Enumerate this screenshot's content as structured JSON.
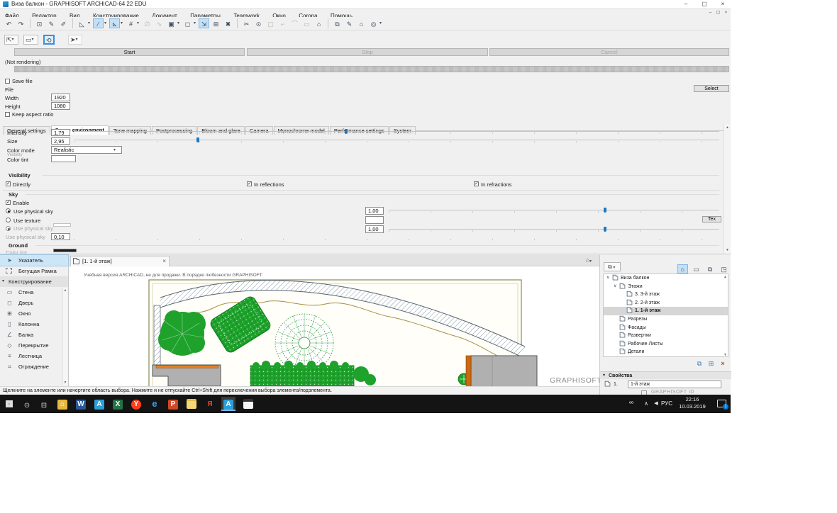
{
  "window": {
    "title": "Виза балкон - GRAPHISOFT ARCHICAD-64 22 EDU"
  },
  "icons": {
    "minimize": "–",
    "restore": "▢",
    "close": "×",
    "caret": "▾",
    "expander": "∨",
    "up": "▲",
    "down": "▼",
    "check": "✓",
    "house": "⌂",
    "folder_modes": "▭",
    "layouts": "⧉",
    "publisher": "◳",
    "chooser": "⧉",
    "copy": "⧉",
    "newfolder": "⊞",
    "delete": "×",
    "tab_house": "⌂",
    "people": "ºº",
    "chevron_up": "∧",
    "volume": "◀"
  },
  "menu": {
    "items": [
      "Файл",
      "Редактор",
      "Вид",
      "Конструирование",
      "Документ",
      "Параметры",
      "Teamwork",
      "Окно",
      "Corona",
      "Помощь"
    ]
  },
  "toolbar": {
    "glyphs": [
      "↶",
      "↷",
      "⊡",
      "✎",
      "✐",
      "◺",
      "∕",
      "⊾",
      "#",
      "∅",
      "∿",
      "▣",
      "◻",
      "⇲",
      "⊞",
      "✖",
      "✂",
      "⊙",
      "▢",
      "⌐",
      "⌒",
      "▭",
      "⌂",
      "⧉",
      "✎",
      "⌂",
      "◎"
    ]
  },
  "toolbar2": {
    "glyphs": [
      "⇱",
      "▭",
      "⟲",
      "➤"
    ]
  },
  "render": {
    "start": "Start",
    "stop": "Stop",
    "cancel": "Cancel",
    "status": "(Not rendering)",
    "save_file": "Save file",
    "file": "File",
    "width_label": "Width",
    "width_value": "1920",
    "height_label": "Height",
    "height_value": "1080",
    "keep_aspect": "Keep aspect ratio",
    "select": "Select"
  },
  "tabs": {
    "items": [
      "General settings",
      "Scene environment",
      "Tone mapping",
      "Postprocessing",
      "Bloom and glare",
      "Camera",
      "Monochrome model",
      "Performance settings",
      "System"
    ]
  },
  "scene": {
    "intensity_label": "Intensity",
    "intensity_value": "1,79",
    "size_label": "Size",
    "size_value": "2,95",
    "color_mode_label": "Color mode",
    "color_mode_value": "Realistic",
    "color_tint_label": "Color tint",
    "visibility_header": "Visibility",
    "directly": "Directly",
    "in_reflections": "In reflections",
    "in_refractions": "In refractions",
    "sky_header": "Sky",
    "enable": "Enable",
    "use_physical_sky": "Use physical sky",
    "use_texture": "Use texture",
    "sky_intensity_value": "1,00",
    "sky_intensity2_value": "1,00",
    "ghost_value": "0,10",
    "tex_button": "Tex",
    "ground_header": "Ground"
  },
  "toolbox": {
    "items": [
      "Указатель",
      "Бегущая Рамка",
      "Конструирование",
      "Стена",
      "Дверь",
      "Окно",
      "Колонна",
      "Балка",
      "Перекрытие",
      "Лестница",
      "Ограждение"
    ],
    "glyphs": [
      "➤",
      "▢",
      "",
      "▭",
      "◻",
      "⊞",
      "▯",
      "∠",
      "◇",
      "≡",
      "⌗"
    ]
  },
  "viewport": {
    "tab": "[1. 1-й этаж]",
    "watermark": "Учебная версия ARCHICAD, не для продажи. В порядке любезности GRAPHISOFT.",
    "brand": "GRAPHISOFT."
  },
  "navigator": {
    "items": [
      "Виза балкон",
      "Этажи",
      "3. 3-й этаж",
      "2. 2-й этаж",
      "1. 1-й этаж",
      "Разрезы",
      "Фасады",
      "Развертки",
      "Рабочие Листы",
      "Детали"
    ],
    "properties": "Свойства",
    "prop_index": "1.",
    "prop_value": "1-й этаж",
    "id_label": "GRAPHISOFT ID"
  },
  "statusbar": {
    "text": "Щелкните на элементе или начертите область выбора. Нажмите и не отпускайте Ctrl+Shift для переключения выбора элемента/подэлемента."
  },
  "taskbar": {
    "lang": "РУС",
    "time": "22:16",
    "date": "10.03.2019",
    "badge": "1",
    "letters": {
      "word": "W",
      "archicad": "A",
      "excel": "X",
      "yandex_browser": "Y",
      "ie": "e",
      "powerpoint": "P",
      "yandex": "Я"
    }
  },
  "colors": {
    "accent": "#1b79c4",
    "toolbar_highlight": "#c4e0f6",
    "selection": "#cde6f7",
    "green": "#1ea22c",
    "slab": "#b0b0b0",
    "orange": "#e6801e"
  }
}
